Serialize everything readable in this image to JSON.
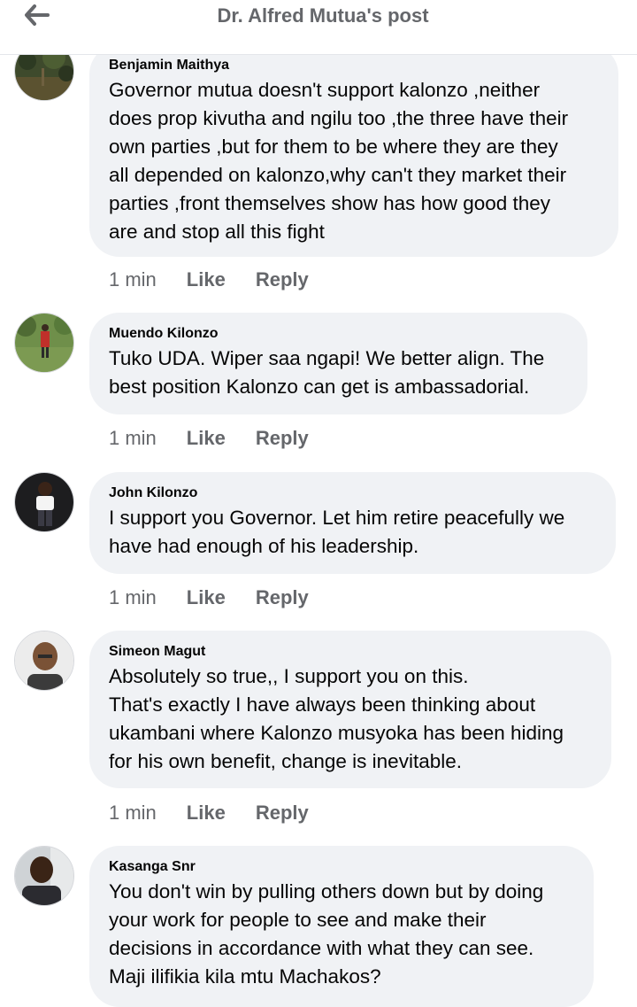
{
  "header": {
    "title": "Dr. Alfred Mutua's post"
  },
  "comments": [
    {
      "author": "Benjamin Maithya",
      "text": "Governor mutua doesn't support kalonzo ,neither\ndoes prop kivutha and ngilu too ,the three have their\nown parties ,but for them to be where they are they\nall depended on kalonzo,why can't they market their\nparties ,front themselves show has how good they\nare and stop all this fight",
      "time": "1 min",
      "like": "Like",
      "reply": "Reply"
    },
    {
      "author": "Muendo Kilonzo",
      "text": "Tuko UDA. Wiper saa ngapi! We better align. The\nbest position Kalonzo can get is  ambassadorial.",
      "time": "1 min",
      "like": "Like",
      "reply": "Reply"
    },
    {
      "author": "John Kilonzo",
      "text": "I support you Governor. Let him retire peacefully we\nhave had enough of his leadership.",
      "time": "1 min",
      "like": "Like",
      "reply": "Reply"
    },
    {
      "author": "Simeon Magut",
      "text": "Absolutely so true,, I support you on this.\nThat's exactly I have always been thinking about\nukambani where Kalonzo musyoka has been hiding\nfor his own benefit, change is inevitable.",
      "time": "1 min",
      "like": "Like",
      "reply": "Reply"
    },
    {
      "author": "Kasanga Snr",
      "text": "You don't win by pulling others down but by doing\nyour work for people to see and make their\ndecisions in accordance with what they can see.\nMaji ilifikia kila mtu Machakos?"
    }
  ]
}
